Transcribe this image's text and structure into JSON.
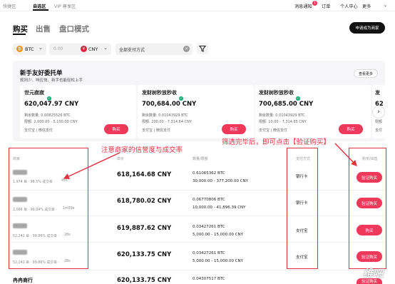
{
  "top_nav": {
    "items": [
      "快捷区",
      "自选区",
      "VIP 尊享区"
    ],
    "right": [
      "消息通知",
      "订单",
      "个人中心",
      "更多"
    ],
    "badge": "1"
  },
  "tabs": [
    "购买",
    "出售",
    "盘口模式"
  ],
  "apply_label": "申请成为商家",
  "filters": {
    "coin": "BTC",
    "amount_placeholder": "0.00",
    "currency": "CNY",
    "payment": "全部支付方式"
  },
  "promo": {
    "title": "新手友好委托单",
    "subtitle": "规则少、响应快、新手也能轻松上手",
    "see_all": "查看更多",
    "cards": [
      {
        "name": "世元寂寂",
        "price": "620,047.97 CNY",
        "remaining": "剩余数量: 0.00825526 BTC",
        "limit": "限额: 2,000.00 - 5,100.00 CNY",
        "pay": "支付宝  |  微信支付",
        "buy": "购买"
      },
      {
        "name": "发财树秒放秒收",
        "price": "700,684.00 CNY",
        "remaining": "剩余数量: 0.01043929 BTC",
        "limit": "限额: 200.00 - 7,314.64 CNY",
        "pay": "支付宝  |  微信支付",
        "buy": "购买"
      },
      {
        "name": "发财树秒放秒收",
        "price": "700,685.00 CNY",
        "remaining": "剩余数量: 0.01043929 BTC",
        "limit": "限额: 10.00 - 7,314.65 CNY",
        "pay": "支付宝  |  微信支付",
        "buy": "购买"
      },
      {
        "name": "发",
        "price": "62",
        "remaining": "剩余",
        "limit": "限额",
        "pay": "支付"
      }
    ]
  },
  "table": {
    "headers": [
      "商家",
      "单价",
      "数量/限额",
      "支付方式",
      "购买/出售"
    ],
    "rows": [
      {
        "stats": "1,974 单  ·  98.5% 成交率  ·",
        "time": "45s",
        "price": "618,164.68 CNY",
        "qty": "0.61065362 BTC",
        "limit": "30,000.00 - 377,200.00 CNY",
        "pay": "银行卡",
        "action": "验证购买"
      },
      {
        "stats": "2,066 单  ·  99.04% 成交率  ·",
        "time": "1m59s",
        "price": "618,780.02 CNY",
        "qty": "0.06770806 BTC",
        "limit": "10,000.00 - 41,896.39 CNY",
        "pay": "银行卡",
        "action": "验证购买"
      },
      {
        "stats": "52,242 单  ·  99.86% 成交率  ·",
        "time": "28s",
        "price": "619,887.62 CNY",
        "qty": "0.03427261 BTC",
        "limit": "5,000.00 - 15,000.00 CNY",
        "pay": "支付宝",
        "action": "购买"
      },
      {
        "stats": "52,242 单  ·  99.86% 成交率  ·",
        "time": "28s",
        "price": "620,133.75 CNY",
        "qty": "0.03427261 BTC",
        "limit": "5,000.00 - 15,000.00 CNY",
        "pay": "支付宝",
        "action": "验证购买"
      },
      {
        "name": "冉冉商行",
        "price": "620,133.75 CNY",
        "qty": "0.04307517 BTC",
        "action": "验证购买"
      }
    ]
  },
  "annotations": {
    "left": "注意商家的信誉度与成交率",
    "right": "筛选完毕后，即可点击【验证购买】"
  },
  "watermark": "维吧",
  "colors": {
    "accent": "#f0385a",
    "annotation": "#e03040",
    "btc": "#f7931a",
    "cny": "#d7263d"
  },
  "icons": [
    "btc-coin-icon",
    "cny-coin-icon",
    "clear-icon",
    "filter-icon",
    "chevron-right-icon",
    "verified-icon"
  ]
}
